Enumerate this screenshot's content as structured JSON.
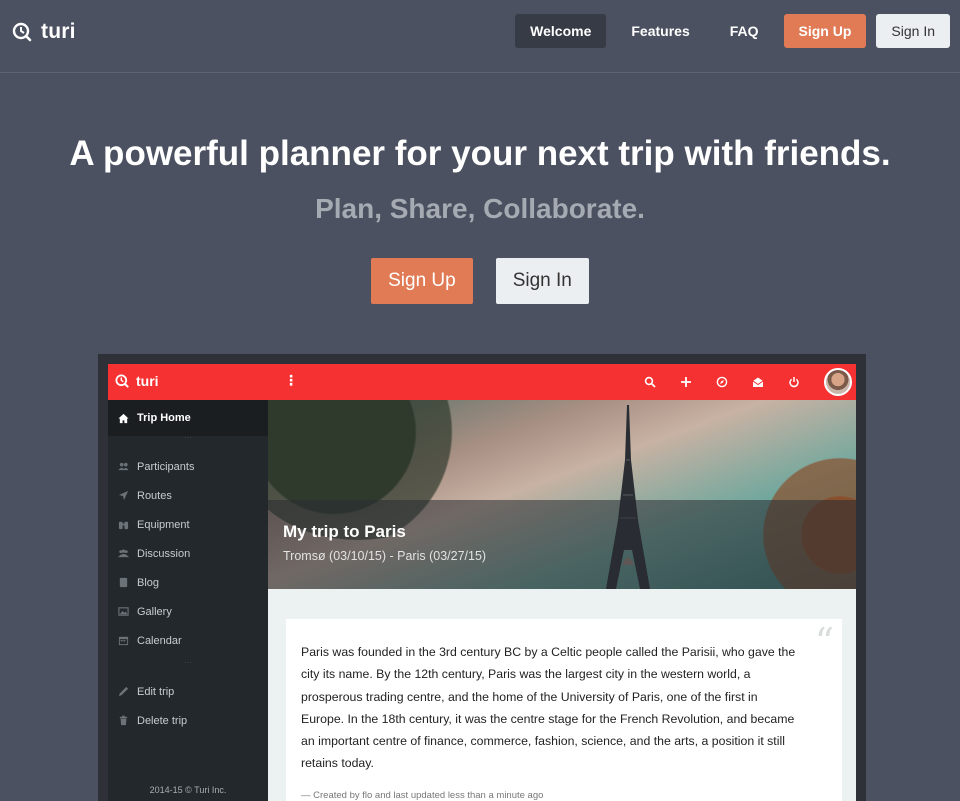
{
  "topbar": {
    "brand": "turi",
    "nav": [
      {
        "label": "Welcome",
        "active": true
      },
      {
        "label": "Features",
        "active": false
      },
      {
        "label": "FAQ",
        "active": false
      }
    ],
    "signup_label": "Sign Up",
    "signin_label": "Sign In"
  },
  "hero": {
    "title": "A powerful planner for your next trip with friends.",
    "subtitle": "Plan, Share, Collaborate.",
    "signup_label": "Sign Up",
    "signin_label": "Sign In"
  },
  "preview": {
    "app_brand": "turi",
    "menu_dots": "⋮",
    "toolbar_icons": [
      "search-icon",
      "plus-icon",
      "compass-icon",
      "mail-icon",
      "power-icon"
    ],
    "sidebar": {
      "active_item": "Trip Home",
      "sep": "···",
      "items": [
        "Participants",
        "Routes",
        "Equipment",
        "Discussion",
        "Blog",
        "Gallery",
        "Calendar"
      ],
      "actions": [
        "Edit trip",
        "Delete trip"
      ],
      "footer": "2014-15 © Turi Inc."
    },
    "trip": {
      "title": "My trip to Paris",
      "dates": "Tromsø (03/10/15) - Paris (03/27/15)"
    },
    "card": {
      "quote_mark": "“",
      "text": "Paris was founded in the 3rd century BC by a Celtic people called the Parisii, who gave the city its name. By the 12th century, Paris was the largest city in the western world, a prosperous trading centre, and the home of the University of Paris, one of the first in Europe. In the 18th century, it was the centre stage for the French Revolution, and became an important centre of finance, commerce, fashion, science, and the arts, a position it still retains today.",
      "meta": "— Created by flo and last updated less than a minute ago"
    }
  },
  "colors": {
    "background": "#4b5160",
    "accent": "#e07b56",
    "app_bar": "#f63131",
    "sidebar": "#23282c"
  }
}
